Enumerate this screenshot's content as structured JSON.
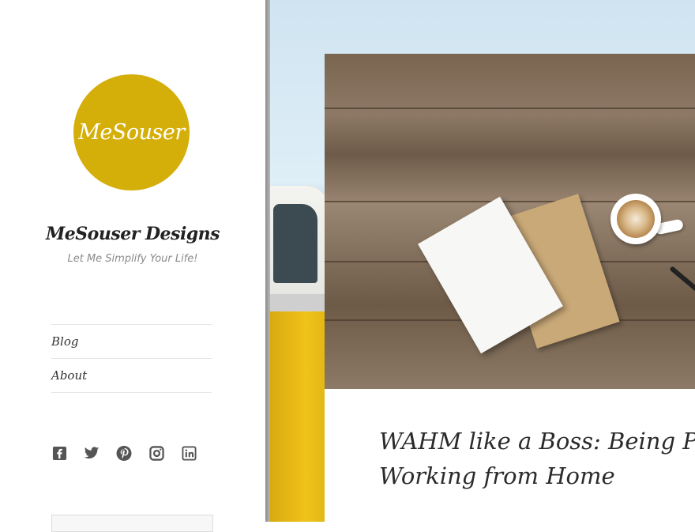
{
  "site": {
    "logo_text": "MeSouser",
    "logo_color": "#d4ae09",
    "title": "MeSouser Designs",
    "tagline": "Let Me Simplify Your Life!"
  },
  "nav": {
    "items": [
      {
        "label": "Blog"
      },
      {
        "label": "About"
      }
    ]
  },
  "social": {
    "icons": [
      "facebook-icon",
      "twitter-icon",
      "pinterest-icon",
      "instagram-icon",
      "linkedin-icon"
    ]
  },
  "post": {
    "title": "WAHM like a Boss: Being P\nWorking from Home"
  }
}
